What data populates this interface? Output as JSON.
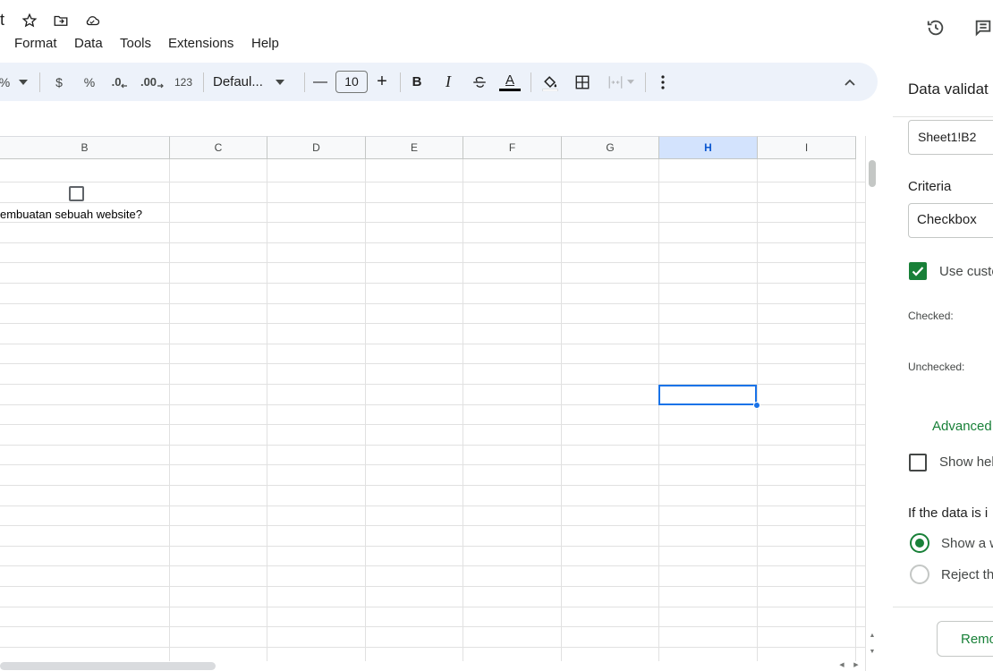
{
  "title_fragment": "t",
  "menu": [
    "Format",
    "Data",
    "Tools",
    "Extensions",
    "Help"
  ],
  "toolbar": {
    "percent_fragment": "%",
    "currency": "$",
    "percent": "%",
    "decrease_decimal": ".0",
    "increase_decimal": ".00",
    "number_format": "123",
    "font_name": "Defaul...",
    "font_minus": "—",
    "font_size": "10",
    "font_plus": "+",
    "bold": "B",
    "italic": "I",
    "text_color_letter": "A"
  },
  "columns": [
    "B",
    "C",
    "D",
    "E",
    "F",
    "G",
    "H",
    "I"
  ],
  "active_column": "H",
  "cells": {
    "b3_text": "embuatan sebuah website?"
  },
  "side_panel": {
    "title": "Data validat",
    "range": "Sheet1!B2",
    "criteria_label": "Criteria",
    "criteria_value": "Checkbox",
    "custom_values_label": "Use custo",
    "checked_label": "Checked:",
    "unchecked_label": "Unchecked:",
    "advanced_label": "Advanced",
    "show_help_label": "Show hel",
    "invalid_label": "If the data is i",
    "option_warning": "Show a w",
    "option_reject": "Reject th",
    "remove_button": "Remo"
  },
  "colors": {
    "accent_green": "#188038",
    "selection_blue": "#1a73e8",
    "toolbar_bg": "#edf2fa"
  }
}
